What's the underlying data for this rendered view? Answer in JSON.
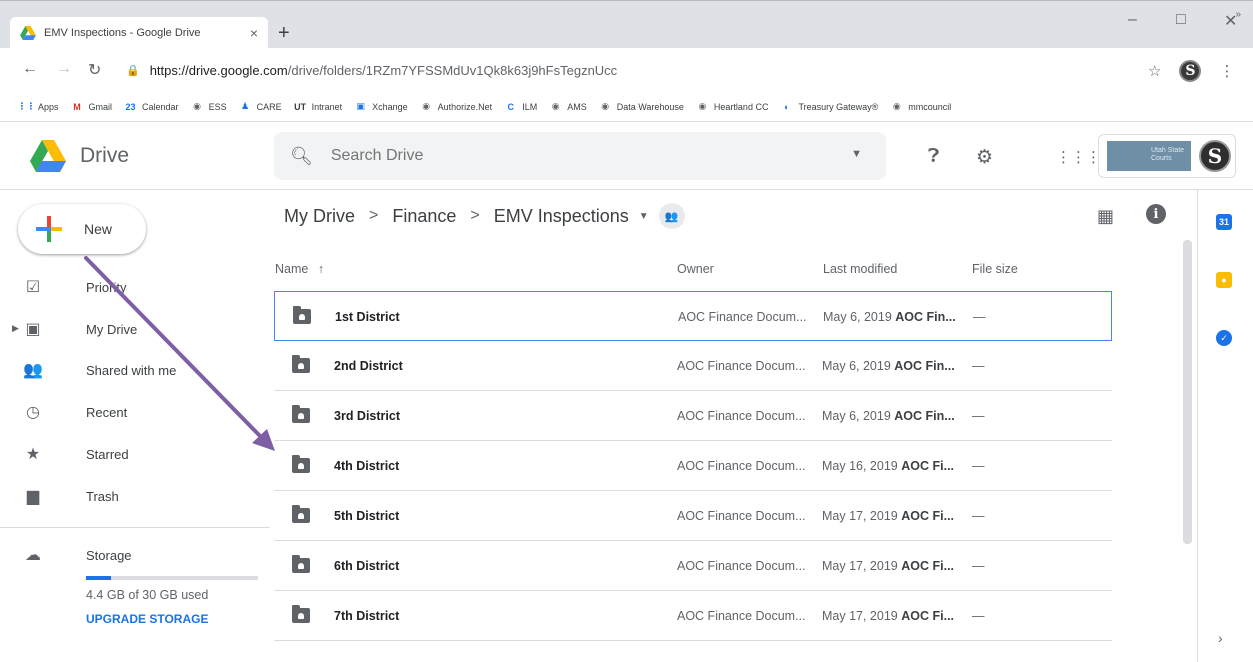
{
  "browser": {
    "tab_title": "EMV Inspections - Google Drive",
    "tab_close": "×",
    "new_tab": "+",
    "minimize": "–",
    "maximize": "□",
    "close": "✕",
    "url_host": "https://drive.google.com",
    "url_path": "/drive/folders/1RZm7YFSSMdUv1Qk8k63j9hFsTegznUcc",
    "avatar_letter": "S"
  },
  "bookmarks": [
    {
      "label": "Apps",
      "icon": "apps-grid-icon",
      "glyph": "⋮⋮",
      "color": "#1a73e8"
    },
    {
      "label": "Gmail",
      "icon": "gmail-icon",
      "glyph": "M",
      "color": "#d93025"
    },
    {
      "label": "Calendar",
      "icon": "calendar-icon",
      "glyph": "23",
      "color": "#1a73e8"
    },
    {
      "label": "ESS",
      "icon": "globe-icon",
      "glyph": "◉",
      "color": "#5f6368"
    },
    {
      "label": "CARE",
      "icon": "person-icon",
      "glyph": "♟",
      "color": "#1a73e8"
    },
    {
      "label": "Intranet",
      "icon": "ut-logo-icon",
      "glyph": "UT",
      "color": "#3c4043"
    },
    {
      "label": "Xchange",
      "icon": "xchange-icon",
      "glyph": "▣",
      "color": "#1a73e8"
    },
    {
      "label": "Authorize.Net",
      "icon": "globe-icon",
      "glyph": "◉",
      "color": "#5f6368"
    },
    {
      "label": "ILM",
      "icon": "c-logo-icon",
      "glyph": "C",
      "color": "#1a73e8"
    },
    {
      "label": "AMS",
      "icon": "globe-icon",
      "glyph": "◉",
      "color": "#5f6368"
    },
    {
      "label": "Data Warehouse",
      "icon": "globe-icon",
      "glyph": "◉",
      "color": "#5f6368"
    },
    {
      "label": "Heartland CC",
      "icon": "globe-icon",
      "glyph": "◉",
      "color": "#5f6368"
    },
    {
      "label": "Treasury Gateway®",
      "icon": "treasury-icon",
      "glyph": "◐",
      "color": "#1a73e8"
    },
    {
      "label": "mmcouncil",
      "icon": "globe-icon",
      "glyph": "◉",
      "color": "#5f6368"
    }
  ],
  "bookmarks_more": "»",
  "drive": {
    "product_name": "Drive",
    "search_placeholder": "Search Drive",
    "account_org": "Utah State Courts",
    "account_letter": "S"
  },
  "sidebar": {
    "new_label": "New",
    "items": [
      {
        "label": "Priority",
        "icon": "priority-icon",
        "glyph": "☑"
      },
      {
        "label": "My Drive",
        "icon": "my-drive-icon",
        "glyph": "▣"
      },
      {
        "label": "Shared with me",
        "icon": "shared-with-me-icon",
        "glyph": "👥"
      },
      {
        "label": "Recent",
        "icon": "clock-icon",
        "glyph": "◷"
      },
      {
        "label": "Starred",
        "icon": "star-icon",
        "glyph": "★"
      },
      {
        "label": "Trash",
        "icon": "trash-icon",
        "glyph": "▆"
      }
    ],
    "storage_label": "Storage",
    "storage_used": "4.4 GB of 30 GB used",
    "storage_fraction": 0.147,
    "upgrade_label": "UPGRADE STORAGE"
  },
  "breadcrumb": {
    "items": [
      "My Drive",
      "Finance",
      "EMV Inspections"
    ],
    "separator": ">"
  },
  "columns": {
    "name": "Name",
    "sort_arrow": "↑",
    "owner": "Owner",
    "last_modified": "Last modified",
    "file_size": "File size"
  },
  "files": [
    {
      "name": "1st District",
      "owner": "AOC Finance Docum...",
      "date": "May 6, 2019",
      "by": "AOC Fin...",
      "size": "—",
      "selected": true
    },
    {
      "name": "2nd District",
      "owner": "AOC Finance Docum...",
      "date": "May 6, 2019",
      "by": "AOC Fin...",
      "size": "—"
    },
    {
      "name": "3rd District",
      "owner": "AOC Finance Docum...",
      "date": "May 6, 2019",
      "by": "AOC Fin...",
      "size": "—"
    },
    {
      "name": "4th District",
      "owner": "AOC Finance Docum...",
      "date": "May 16, 2019",
      "by": "AOC Fi...",
      "size": "—"
    },
    {
      "name": "5th District",
      "owner": "AOC Finance Docum...",
      "date": "May 17, 2019",
      "by": "AOC Fi...",
      "size": "—"
    },
    {
      "name": "6th District",
      "owner": "AOC Finance Docum...",
      "date": "May 17, 2019",
      "by": "AOC Fi...",
      "size": "—"
    },
    {
      "name": "7th District",
      "owner": "AOC Finance Docum...",
      "date": "May 17, 2019",
      "by": "AOC Fi...",
      "size": "—"
    }
  ],
  "colors": {
    "accent": "#1a73e8",
    "selection_border": "#4285f4",
    "annotation_arrow": "#7e5fa6"
  }
}
